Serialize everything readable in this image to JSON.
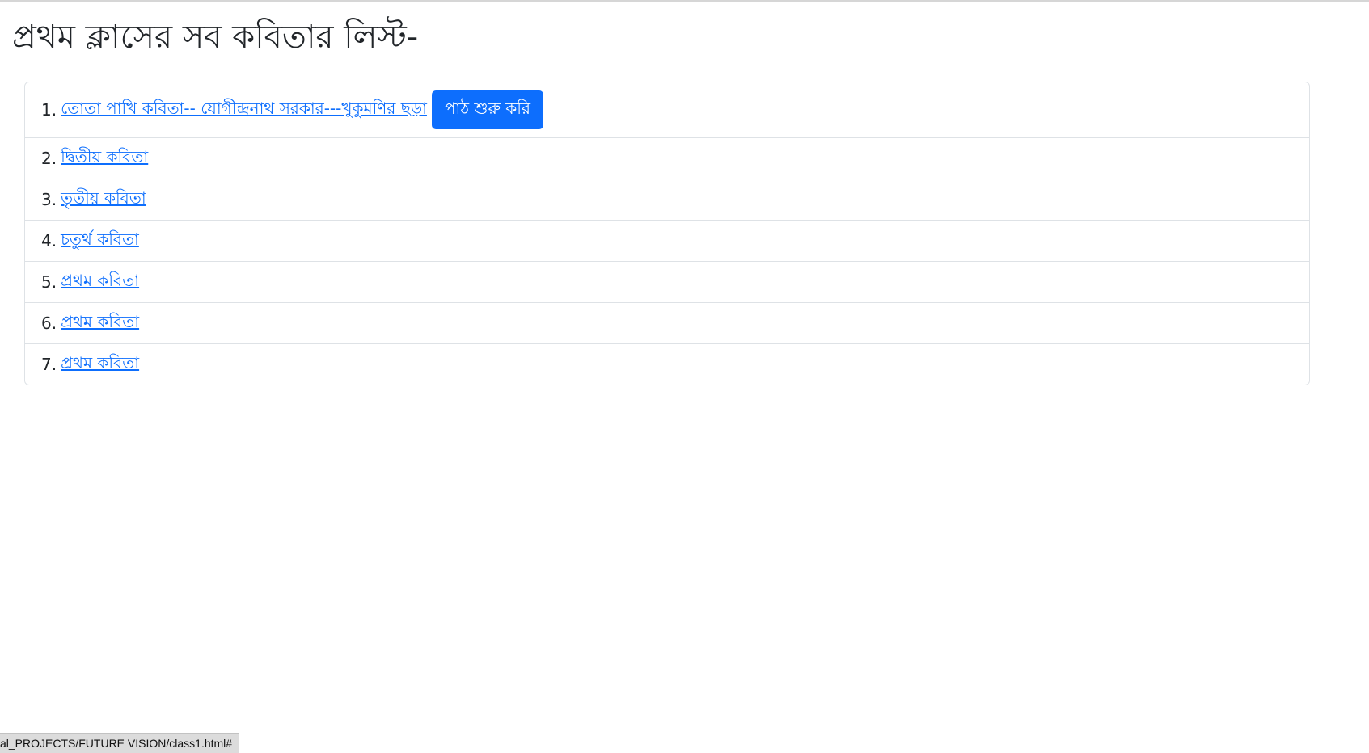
{
  "page": {
    "title": "প্রথম ক্লাসের সব কবিতার লিস্ট-"
  },
  "poems": [
    {
      "number": "1.",
      "title": "তোতা পাখি কবিতা-- যোগীন্দ্রনাথ সরকার---খুকুমণির ছড়া",
      "button_label": "পাঠ শুরু করি"
    },
    {
      "number": "2.",
      "title": "দ্বিতীয় কবিতা"
    },
    {
      "number": "3.",
      "title": "তৃতীয় কবিতা"
    },
    {
      "number": "4.",
      "title": "চতুর্থ কবিতা"
    },
    {
      "number": "5.",
      "title": "প্রথম কবিতা"
    },
    {
      "number": "6.",
      "title": "প্রথম কবিতা"
    },
    {
      "number": "7.",
      "title": "প্রথম কবিতা"
    }
  ],
  "status_bar": {
    "url": "al_PROJECTS/FUTURE VISION/class1.html#"
  },
  "colors": {
    "link": "#0d6efd",
    "button_bg": "#0d6efd",
    "border": "#dee2e6"
  }
}
